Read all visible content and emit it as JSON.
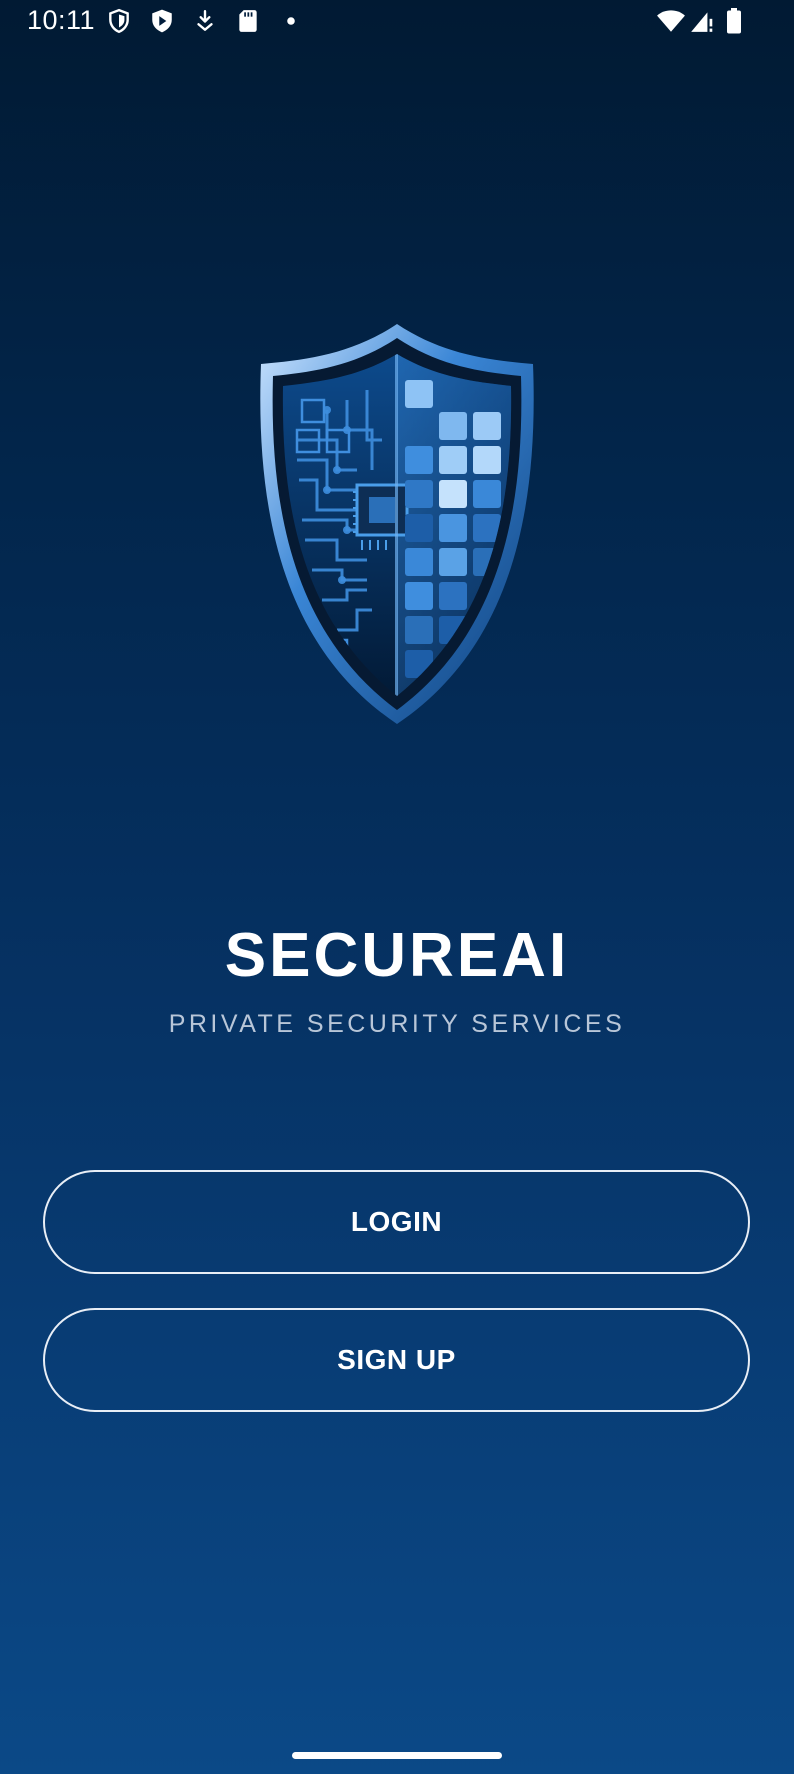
{
  "status_bar": {
    "time": "10:11",
    "left_icons": [
      "shield-icon",
      "play-protect-icon",
      "download-icon",
      "sd-card-icon",
      "dot-icon"
    ],
    "right_icons": [
      "wifi-icon",
      "cell-signal-icon",
      "battery-icon"
    ]
  },
  "logo": {
    "icon": "shield-circuit-icon",
    "accent": "#4a9eea"
  },
  "app": {
    "title": "SECUREAI",
    "subtitle": "PRIVATE SECURITY SERVICES"
  },
  "actions": {
    "login_label": "LOGIN",
    "signup_label": "SIGN UP"
  },
  "colors": {
    "background_top": "#011a33",
    "background_bottom": "#0b4987",
    "subtitle": "#b8c6d8",
    "button_border": "#e8eef6"
  }
}
